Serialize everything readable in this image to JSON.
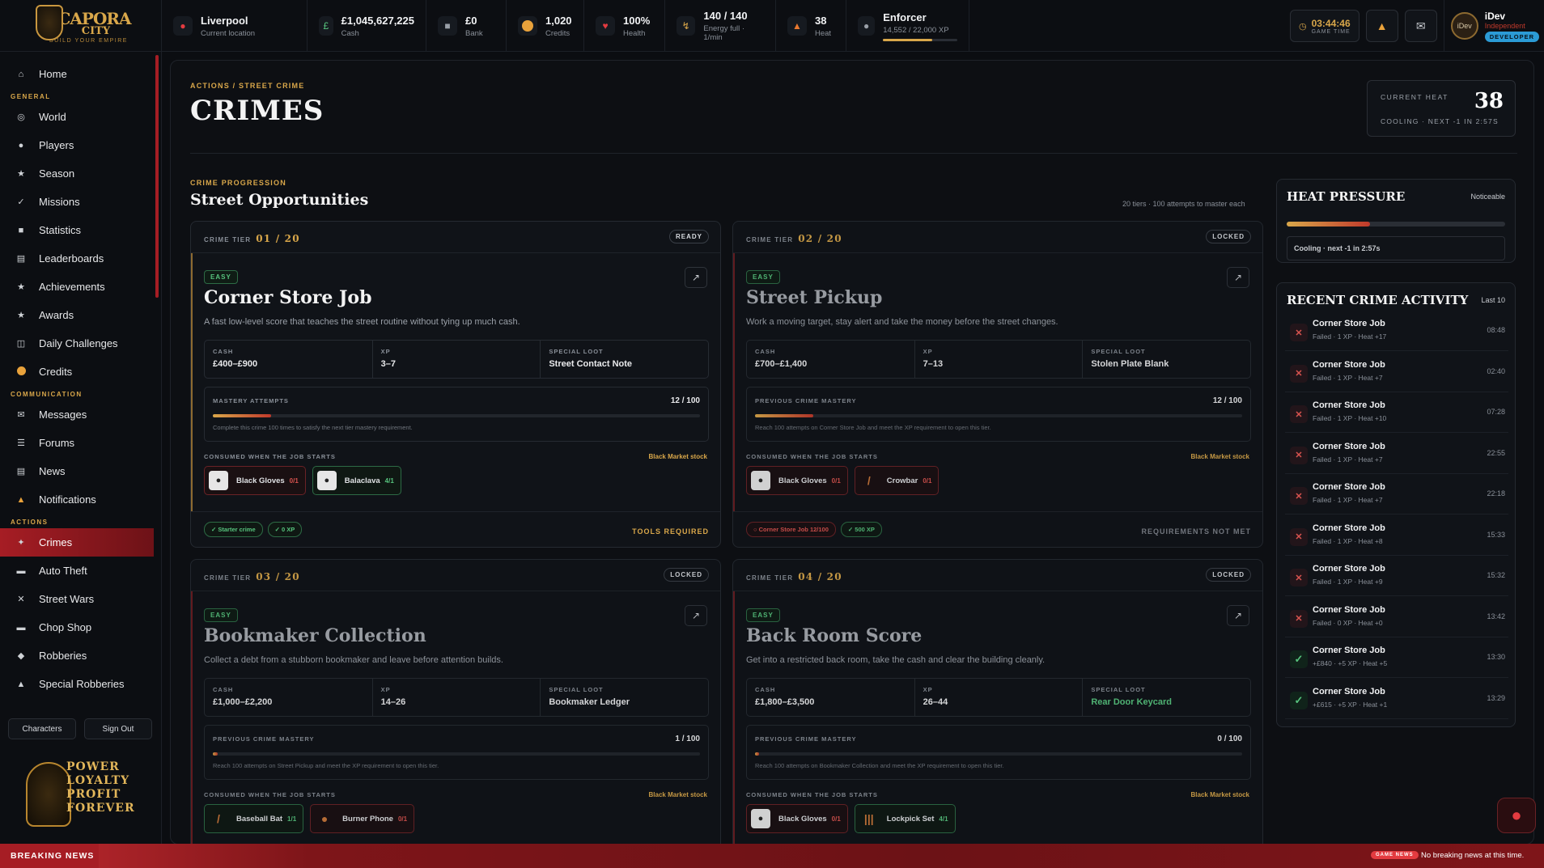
{
  "brand": {
    "line1": "CAPORA",
    "line2": "CITY",
    "tagline": "BUILD YOUR EMPIRE"
  },
  "topbar": {
    "location": {
      "value": "Liverpool",
      "label": "Current location",
      "icon": "pin-icon"
    },
    "cash": {
      "value": "£1,045,627,225",
      "label": "Cash",
      "icon": "pound-icon"
    },
    "bank": {
      "value": "£0",
      "label": "Bank",
      "icon": "bank-icon"
    },
    "credits": {
      "value": "1,020",
      "label": "Credits",
      "icon": "coin-icon"
    },
    "health": {
      "value": "100%",
      "label": "Health",
      "icon": "heart-icon"
    },
    "energy": {
      "value": "140 / 140",
      "label": "Energy full · 1/min",
      "icon": "bolt-icon"
    },
    "heat": {
      "value": "38",
      "label": "Heat",
      "icon": "flame-icon"
    },
    "rank": {
      "value": "Enforcer",
      "label": "14,552 / 22,000 XP",
      "progress": 0.66,
      "icon": "person-icon"
    },
    "game_time": {
      "value": "03:44:46",
      "label": "GAME TIME"
    },
    "user": {
      "name": "iDev",
      "status": "Independent",
      "badge": "DEVELOPER",
      "avatar_text": "iDev"
    }
  },
  "sidebar": {
    "home": "Home",
    "sections": [
      {
        "title": "GENERAL",
        "items": [
          "World",
          "Players",
          "Season",
          "Missions",
          "Statistics",
          "Leaderboards",
          "Achievements",
          "Awards",
          "Daily Challenges",
          "Credits"
        ]
      },
      {
        "title": "COMMUNICATION",
        "items": [
          "Messages",
          "Forums",
          "News",
          "Notifications"
        ]
      },
      {
        "title": "ACTIONS",
        "items": [
          "Crimes",
          "Auto Theft",
          "Street Wars",
          "Chop Shop",
          "Robberies",
          "Special Robberies"
        ]
      }
    ],
    "characters_button": "Characters",
    "signout_button": "Sign Out",
    "promo": [
      "POWER",
      "LOYALTY",
      "PROFIT",
      "FOREVER"
    ]
  },
  "page": {
    "breadcrumb": "ACTIONS / STREET CRIME",
    "title": "CRIMES",
    "heat": {
      "label": "CURRENT HEAT",
      "value": "38",
      "sub": "COOLING · NEXT -1 IN 2:57S"
    },
    "section_label": "CRIME PROGRESSION",
    "section_title": "Street Opportunities",
    "section_note": "20 tiers · 100 attempts to master each"
  },
  "crimes": [
    {
      "tier_label": "CRIME TIER",
      "tier": "01 / 20",
      "state": "READY",
      "difficulty": "EASY",
      "name": "Corner Store Job",
      "desc": "A fast low-level score that teaches the street routine without tying up much cash.",
      "cash_label": "CASH",
      "cash": "£400–£900",
      "xp_label": "XP",
      "xp": "3–7",
      "loot_label": "SPECIAL LOOT",
      "loot": "Street Contact Note",
      "mastery_label": "MASTERY ATTEMPTS",
      "mastery": "12 / 100",
      "mastery_progress": 0.12,
      "mastery_note": "Complete this crime 100 times to satisfy the next tier mastery requirement.",
      "consumed_label": "CONSUMED WHEN THE JOB STARTS",
      "market": "Black Market stock",
      "items": [
        {
          "name": "Black Gloves",
          "count": "0/1",
          "ok": false,
          "icon": "gloves-icon"
        },
        {
          "name": "Balaclava",
          "count": "4/1",
          "ok": true,
          "icon": "balaclava-icon"
        }
      ],
      "reqs": [
        {
          "text": "✓ Starter crime",
          "ok": true
        },
        {
          "text": "✓ 0 XP",
          "ok": true
        }
      ],
      "footer": "TOOLS REQUIRED"
    },
    {
      "tier_label": "CRIME TIER",
      "tier": "02 / 20",
      "state": "LOCKED",
      "difficulty": "EASY",
      "name": "Street Pickup",
      "desc": "Work a moving target, stay alert and take the money before the street changes.",
      "cash_label": "CASH",
      "cash": "£700–£1,400",
      "xp_label": "XP",
      "xp": "7–13",
      "loot_label": "SPECIAL LOOT",
      "loot": "Stolen Plate Blank",
      "mastery_label": "PREVIOUS CRIME MASTERY",
      "mastery": "12 / 100",
      "mastery_progress": 0.12,
      "mastery_note": "Reach 100 attempts on Corner Store Job and meet the XP requirement to open this tier.",
      "consumed_label": "CONSUMED WHEN THE JOB STARTS",
      "market": "Black Market stock",
      "items": [
        {
          "name": "Black Gloves",
          "count": "0/1",
          "ok": false,
          "icon": "gloves-icon"
        },
        {
          "name": "Crowbar",
          "count": "0/1",
          "ok": false,
          "icon": "crowbar-icon"
        }
      ],
      "reqs": [
        {
          "text": "○ Corner Store Job 12/100",
          "ok": false
        },
        {
          "text": "✓ 500 XP",
          "ok": true
        }
      ],
      "footer": "REQUIREMENTS NOT MET"
    },
    {
      "tier_label": "CRIME TIER",
      "tier": "03 / 20",
      "state": "LOCKED",
      "difficulty": "EASY",
      "name": "Bookmaker Collection",
      "desc": "Collect a debt from a stubborn bookmaker and leave before attention builds.",
      "cash_label": "CASH",
      "cash": "£1,000–£2,200",
      "xp_label": "XP",
      "xp": "14–26",
      "loot_label": "SPECIAL LOOT",
      "loot": "Bookmaker Ledger",
      "mastery_label": "PREVIOUS CRIME MASTERY",
      "mastery": "1 / 100",
      "mastery_progress": 0.01,
      "mastery_note": "Reach 100 attempts on Street Pickup and meet the XP requirement to open this tier.",
      "consumed_label": "CONSUMED WHEN THE JOB STARTS",
      "market": "Black Market stock",
      "items": [
        {
          "name": "Baseball Bat",
          "count": "1/1",
          "ok": true,
          "icon": "bat-icon"
        },
        {
          "name": "Burner Phone",
          "count": "0/1",
          "ok": false,
          "icon": "phone-icon"
        }
      ],
      "reqs": [],
      "footer": ""
    },
    {
      "tier_label": "CRIME TIER",
      "tier": "04 / 20",
      "state": "LOCKED",
      "difficulty": "EASY",
      "name": "Back Room Score",
      "desc": "Get into a restricted back room, take the cash and clear the building cleanly.",
      "cash_label": "CASH",
      "cash": "£1,800–£3,500",
      "xp_label": "XP",
      "xp": "26–44",
      "loot_label": "SPECIAL LOOT",
      "loot": "Rear Door Keycard",
      "mastery_label": "PREVIOUS CRIME MASTERY",
      "mastery": "0 / 100",
      "mastery_progress": 0.0,
      "mastery_note": "Reach 100 attempts on Bookmaker Collection and meet the XP requirement to open this tier.",
      "consumed_label": "CONSUMED WHEN THE JOB STARTS",
      "market": "Black Market stock",
      "items": [
        {
          "name": "Black Gloves",
          "count": "0/1",
          "ok": false,
          "icon": "gloves-icon"
        },
        {
          "name": "Lockpick Set",
          "count": "4/1",
          "ok": true,
          "icon": "lockpick-icon"
        }
      ],
      "reqs": [],
      "footer": ""
    }
  ],
  "heat_pressure": {
    "title": "HEAT PRESSURE",
    "level": "Noticeable",
    "progress": 0.38,
    "note": "Cooling · next -1 in 2:57s"
  },
  "recent": {
    "title": "RECENT CRIME ACTIVITY",
    "range": "Last 10",
    "items": [
      {
        "name": "Corner Store Job",
        "detail": "Failed · 1 XP · Heat +17",
        "time": "08:48",
        "ok": false
      },
      {
        "name": "Corner Store Job",
        "detail": "Failed · 1 XP · Heat +7",
        "time": "02:40",
        "ok": false
      },
      {
        "name": "Corner Store Job",
        "detail": "Failed · 1 XP · Heat +10",
        "time": "07:28",
        "ok": false
      },
      {
        "name": "Corner Store Job",
        "detail": "Failed · 1 XP · Heat +7",
        "time": "22:55",
        "ok": false
      },
      {
        "name": "Corner Store Job",
        "detail": "Failed · 1 XP · Heat +7",
        "time": "22:18",
        "ok": false
      },
      {
        "name": "Corner Store Job",
        "detail": "Failed · 1 XP · Heat +8",
        "time": "15:33",
        "ok": false
      },
      {
        "name": "Corner Store Job",
        "detail": "Failed · 1 XP · Heat +9",
        "time": "15:32",
        "ok": false
      },
      {
        "name": "Corner Store Job",
        "detail": "Failed · 0 XP · Heat +0",
        "time": "13:42",
        "ok": false
      },
      {
        "name": "Corner Store Job",
        "detail": "+£840 · +5 XP · Heat +5",
        "time": "13:30",
        "ok": true
      },
      {
        "name": "Corner Store Job",
        "detail": "+£615 · +5 XP · Heat +1",
        "time": "13:29",
        "ok": true
      }
    ]
  },
  "news": {
    "label": "BREAKING NEWS",
    "badge": "GAME NEWS",
    "text": "No breaking news at this time."
  }
}
